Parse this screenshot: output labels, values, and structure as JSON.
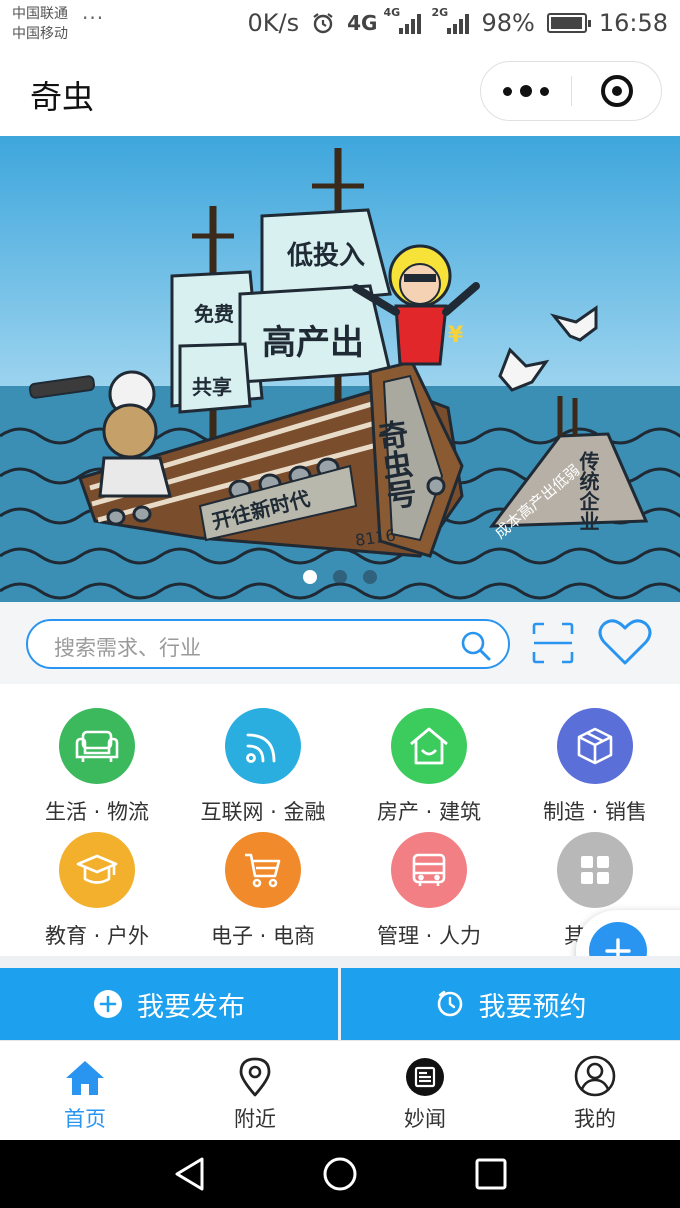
{
  "status_bar": {
    "carrier_1": "中国联通",
    "carrier_2": "中国移动",
    "overflow": "···",
    "net_speed": "0K/s",
    "net_4g": "4G",
    "sig_4g": "4G",
    "sig_2g": "2G",
    "battery": "98%",
    "battery_level": 0.98,
    "time": "16:58"
  },
  "header": {
    "title": "奇虫",
    "icons": [
      "more-icon",
      "close-miniprogram-icon"
    ]
  },
  "banner": {
    "sail_1": "低投入",
    "sail_2": "免费",
    "sail_3": "高产出",
    "sail_4": "共享",
    "ship_name": "奇虫号",
    "ship_number": "8116",
    "hull_text": "开往新时代",
    "wreck_label": "传统企业",
    "wreck_text": "成本高产出低弱",
    "yuan_sign": "¥",
    "slide_count": 3,
    "active_slide": 1
  },
  "search": {
    "placeholder": "搜索需求、行业",
    "icons": [
      "search-icon",
      "scan-icon",
      "favorite-heart-icon"
    ]
  },
  "categories": [
    {
      "label": "生活 · 物流",
      "icon": "sofa-icon",
      "color": "#3cb85d"
    },
    {
      "label": "互联网 · 金融",
      "icon": "rss-icon",
      "color": "#2aaee0"
    },
    {
      "label": "房产 · 建筑",
      "icon": "house-icon",
      "color": "#3ccc5e"
    },
    {
      "label": "制造 · 销售",
      "icon": "box-icon",
      "color": "#5a6fd8"
    },
    {
      "label": "教育 · 户外",
      "icon": "graduation-cap-icon",
      "color": "#f2b02c"
    },
    {
      "label": "电子 · 电商",
      "icon": "cart-icon",
      "color": "#f08a2a"
    },
    {
      "label": "管理 · 人力",
      "icon": "bus-icon",
      "color": "#f27f84"
    },
    {
      "label": "其",
      "icon": "grid-icon",
      "color": "#b8b8b8"
    }
  ],
  "actions": {
    "publish": "我要发布",
    "reserve": "我要预约"
  },
  "tabbar": [
    {
      "label": "首页",
      "icon": "home-icon",
      "active": true
    },
    {
      "label": "附近",
      "icon": "location-pin-icon",
      "active": false
    },
    {
      "label": "妙闻",
      "icon": "news-icon",
      "active": false
    },
    {
      "label": "我的",
      "icon": "user-icon",
      "active": false
    }
  ],
  "colors": {
    "accent": "#2a95f0",
    "action_bg": "#1da1ee"
  }
}
